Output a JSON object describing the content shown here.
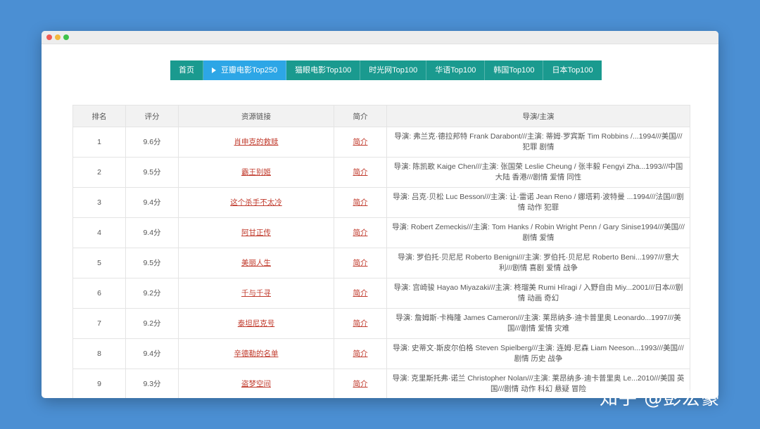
{
  "nav": {
    "items": [
      {
        "label": "首页"
      },
      {
        "label": "豆瓣电影Top250"
      },
      {
        "label": "猫眼电影Top100"
      },
      {
        "label": "时光网Top100"
      },
      {
        "label": "华语Top100"
      },
      {
        "label": "韩国Top100"
      },
      {
        "label": "日本Top100"
      }
    ],
    "active": "豆瓣电影Top250"
  },
  "table": {
    "headers": {
      "rank": "排名",
      "score": "评分",
      "link": "资源链接",
      "intro": "简介",
      "director": "导演/主演"
    },
    "intro_link": "简介",
    "rows": [
      {
        "rank": "1",
        "score": "9.6分",
        "title": "肖申克的救赎",
        "info": "导演: 弗兰克·德拉邦特 Frank Darabont///主演: 蒂姆·罗宾斯 Tim Robbins /...1994///美国///犯罪 剧情"
      },
      {
        "rank": "2",
        "score": "9.5分",
        "title": "霸王别姬",
        "info": "导演: 陈凯歌 Kaige Chen///主演: 张国荣 Leslie Cheung / 张丰毅 Fengyi Zha...1993///中国大陆 香港///剧情 爱情 同性"
      },
      {
        "rank": "3",
        "score": "9.4分",
        "title": "这个杀手不太冷",
        "info": "导演: 吕克·贝松 Luc Besson///主演: 让·雷诺 Jean Reno / 娜塔莉·波特曼 ...1994///法国///剧情 动作 犯罪"
      },
      {
        "rank": "4",
        "score": "9.4分",
        "title": "阿甘正传",
        "info": "导演: Robert Zemeckis///主演: Tom Hanks / Robin Wright Penn / Gary Sinise1994///美国///剧情 爱情"
      },
      {
        "rank": "5",
        "score": "9.5分",
        "title": "美丽人生",
        "info": "导演: 罗伯托·贝尼尼 Roberto Benigni///主演: 罗伯托·贝尼尼 Roberto Beni...1997///意大利///剧情 喜剧 爱情 战争"
      },
      {
        "rank": "6",
        "score": "9.2分",
        "title": "千与千寻",
        "info": "导演: 宫崎骏 Hayao Miyazaki///主演: 柊瑠美 Rumi Hîragi / 入野自由 Miy...2001///日本///剧情 动画 奇幻"
      },
      {
        "rank": "7",
        "score": "9.2分",
        "title": "泰坦尼克号",
        "info": "导演: 詹姆斯·卡梅隆 James Cameron///主演: 莱昂纳多·迪卡普里奥 Leonardo...1997///美国///剧情 爱情 灾难"
      },
      {
        "rank": "8",
        "score": "9.4分",
        "title": "辛德勒的名单",
        "info": "导演: 史蒂文·斯皮尔伯格 Steven Spielberg///主演: 连姆·尼森 Liam Neeson...1993///美国///剧情 历史 战争"
      },
      {
        "rank": "9",
        "score": "9.3分",
        "title": "盗梦空间",
        "info": "导演: 克里斯托弗·诺兰 Christopher Nolan///主演: 莱昂纳多·迪卡普里奥 Le...2010///美国 英国///剧情 动作 科幻 悬疑 冒险"
      }
    ]
  },
  "watermark": "知乎 @彭宏豪"
}
